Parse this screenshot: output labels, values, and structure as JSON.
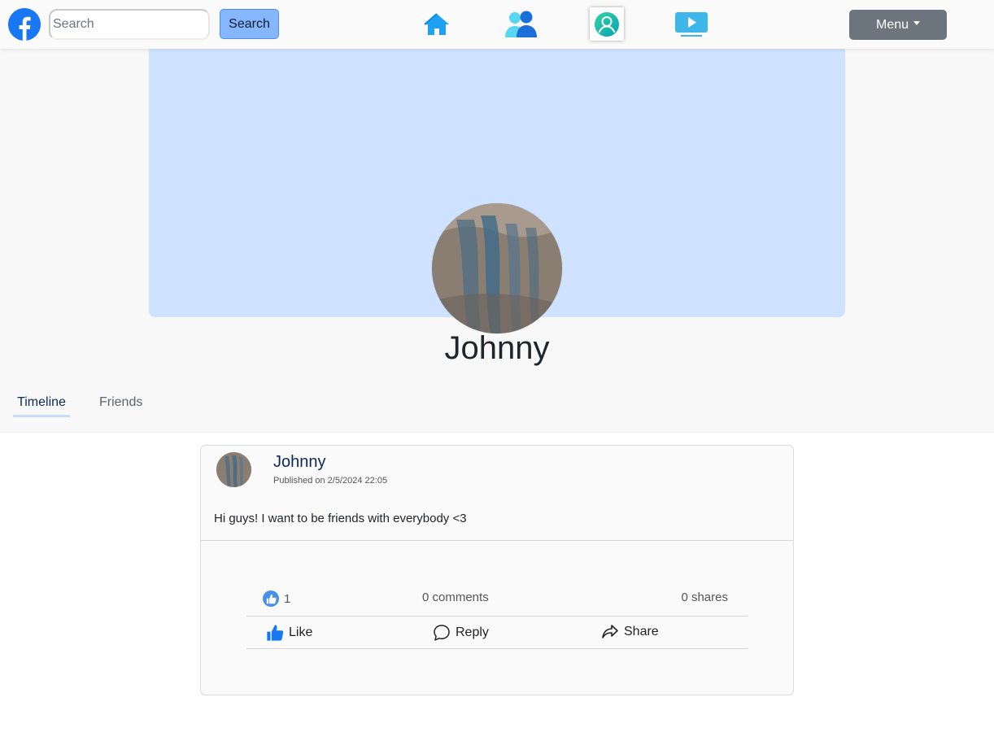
{
  "nav": {
    "logo": "facebook-logo",
    "search_placeholder": "Search",
    "search_button": "Search",
    "icons": [
      "home-icon",
      "friends-icon",
      "profile-icon",
      "watch-icon"
    ],
    "menu_label": "Menu"
  },
  "profile": {
    "name": "Johnny",
    "cover_color": "#cfe2ff",
    "tabs": [
      {
        "label": "Timeline",
        "active": true
      },
      {
        "label": "Friends",
        "active": false
      }
    ]
  },
  "post": {
    "author": "Johnny",
    "published": "Published on 2/5/2024 22:05",
    "text": "Hi guys! I want to be friends with everybody <3",
    "likes": "1",
    "comments": "0 comments",
    "shares": "0 shares",
    "actions": {
      "like": "Like",
      "reply": "Reply",
      "share": "Share"
    }
  },
  "colors": {
    "brand": "#1877f2",
    "accent_button": "#86b7fe",
    "menu_button": "#6c757d",
    "nav_icon": "#1da1f2"
  }
}
